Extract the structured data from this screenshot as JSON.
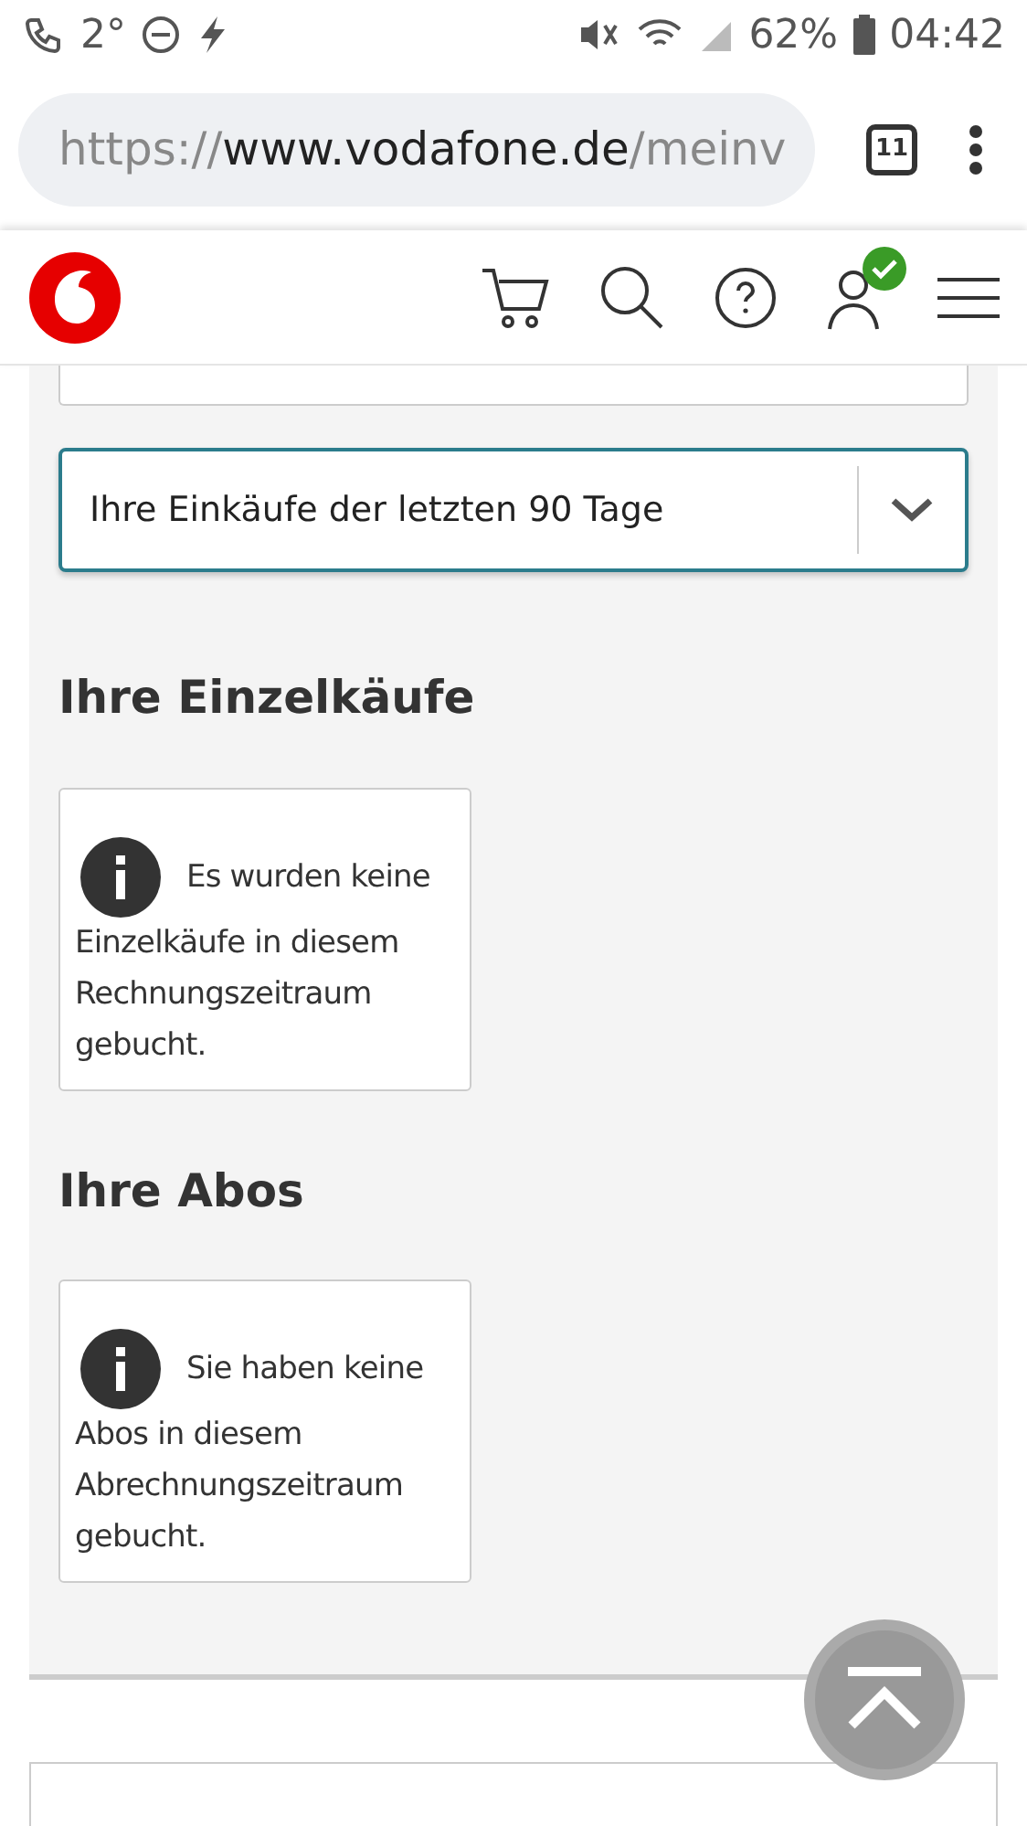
{
  "status_bar": {
    "temperature": "2°",
    "battery": "62%",
    "time": "04:42"
  },
  "browser": {
    "url": {
      "scheme": "https://",
      "host": "www.vodafone.de",
      "path": "/meinv"
    },
    "tab_count": "11"
  },
  "period_select": {
    "value": "Ihre Einkäufe der letzten 90 Tage",
    "focused": true
  },
  "sections": [
    {
      "heading": "Ihre Einzelkäufe",
      "message_lead": "Es wurden keine",
      "message_rest": "Einzelkäufe in diesem Rechnungszeitraum gebucht."
    },
    {
      "heading": "Ihre Abos",
      "message_lead": "Sie haben keine",
      "message_rest": "Abos in diesem Abrechnungszeitraum gebucht."
    }
  ],
  "account": {
    "logged_in": true
  }
}
